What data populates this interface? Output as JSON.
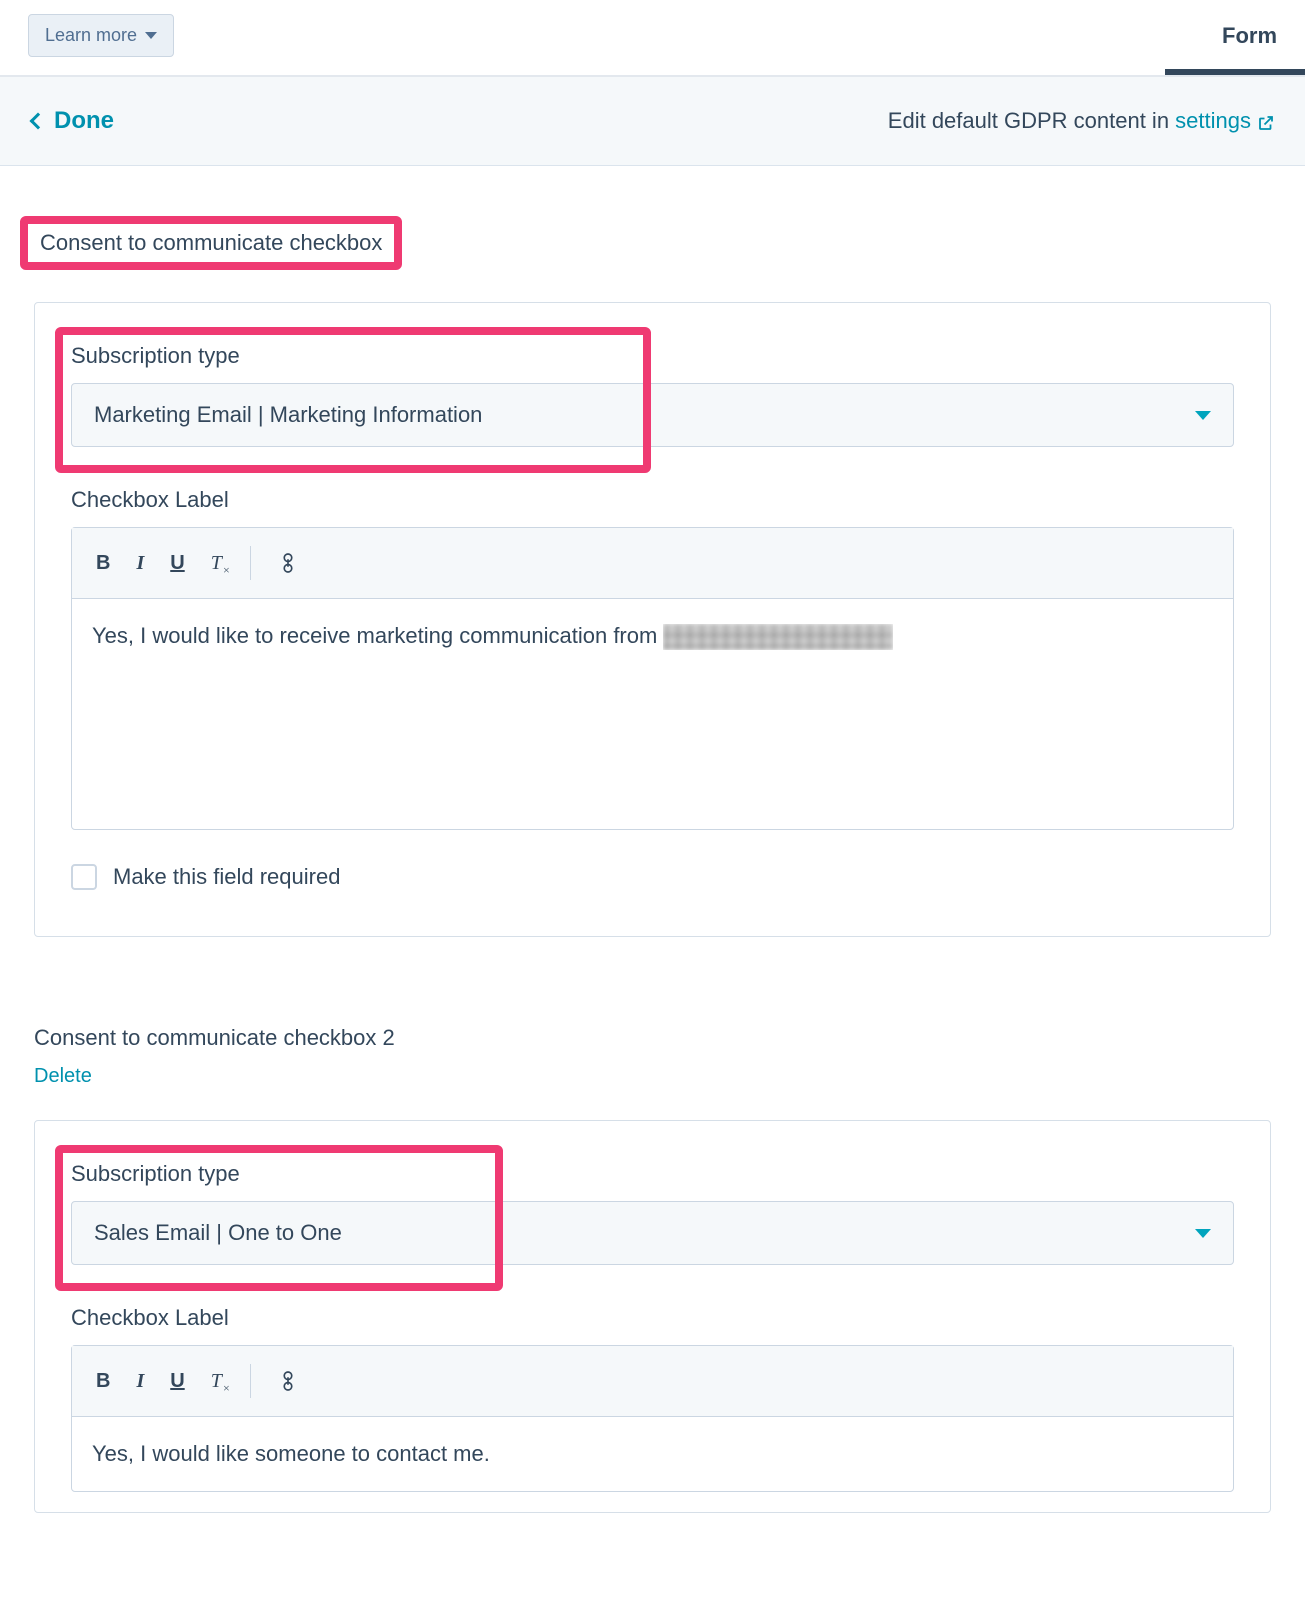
{
  "topbar": {
    "learn_more": "Learn more",
    "form_label": "Form"
  },
  "subheader": {
    "done": "Done",
    "gdpr_prefix": "Edit default GDPR content in ",
    "settings_link": "settings"
  },
  "section1": {
    "title": "Consent to communicate checkbox",
    "subscription_label": "Subscription type",
    "subscription_value": "Marketing Email | Marketing Information",
    "checkbox_label_heading": "Checkbox Label",
    "checkbox_label_text": "Yes, I would like to receive marketing communication from ",
    "required_label": "Make this field required"
  },
  "section2": {
    "title": "Consent to communicate checkbox 2",
    "delete": "Delete",
    "subscription_label": "Subscription type",
    "subscription_value": "Sales Email | One to One",
    "checkbox_label_heading": "Checkbox Label",
    "checkbox_label_text": "Yes, I would like someone to contact me."
  },
  "toolbar": {
    "bold": "B",
    "italic": "I",
    "underline": "U",
    "clear": "T"
  }
}
